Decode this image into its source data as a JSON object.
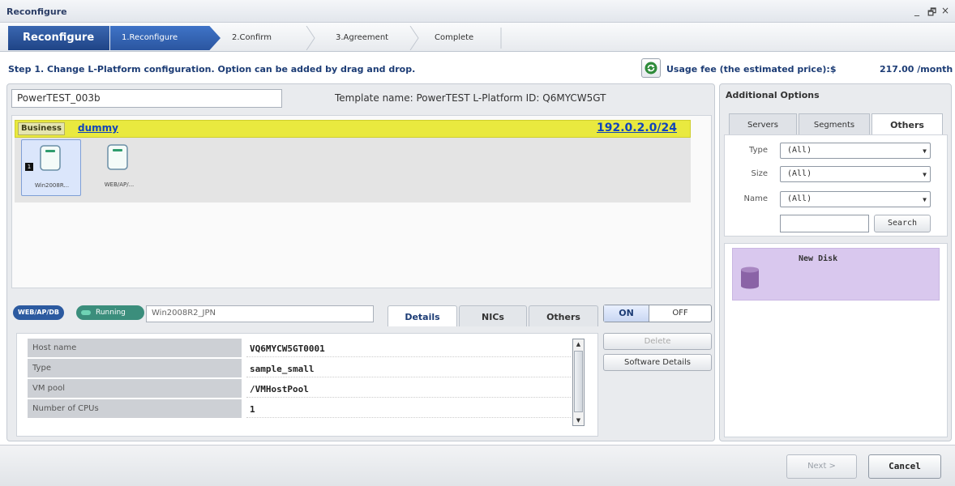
{
  "window": {
    "title": "Reconfigure",
    "controls": {
      "minimize": "_",
      "restore": "🗗",
      "close": "×"
    }
  },
  "wizard": {
    "head": "Reconfigure",
    "steps": [
      {
        "label": "1.Reconfigure"
      },
      {
        "label": "2.Confirm"
      },
      {
        "label": "3.Agreement"
      },
      {
        "label": "Complete"
      }
    ]
  },
  "step_text": "Step 1. Change L-Platform configuration. Option can be added by drag and drop.",
  "usage": {
    "label": "Usage fee (the estimated price):$",
    "value": "217.00 /month"
  },
  "platform": {
    "name": "PowerTEST_003b",
    "template_info": "Template name: PowerTEST  L-Platform ID: Q6MYCW5GT"
  },
  "segment": {
    "badge": "Business",
    "name": "dummy",
    "network": "192.0.2.0/24",
    "servers": [
      {
        "label": "Win2008R...",
        "badge": "1"
      },
      {
        "label": "WEB/AP/..."
      }
    ]
  },
  "server_detail": {
    "type_pill": "WEB/AP/DB",
    "status_pill": "Running",
    "name_field": "Win2008R2_JPN",
    "tabs": [
      "Details",
      "NICs",
      "Others"
    ],
    "toggle": {
      "on": "ON",
      "off": "OFF"
    },
    "delete_label": "Delete",
    "software_label": "Software Details",
    "rows": [
      {
        "key": "Host name",
        "value": "VQ6MYCW5GT0001"
      },
      {
        "key": "Type",
        "value": "sample_small"
      },
      {
        "key": "VM pool",
        "value": "/VMHostPool"
      },
      {
        "key": "Number of CPUs",
        "value": "1"
      }
    ]
  },
  "options": {
    "title": "Additional Options",
    "tabs": [
      "Servers",
      "Segments",
      "Others"
    ],
    "filters": [
      {
        "label": "Type",
        "value": "(All)"
      },
      {
        "label": "Size",
        "value": "(All)"
      },
      {
        "label": "Name",
        "value": "(All)"
      }
    ],
    "search_value": "",
    "search_label": "Search",
    "items": [
      {
        "label": "New Disk",
        "icon": "disk-icon"
      }
    ]
  },
  "footer": {
    "next": "Next >",
    "cancel": "Cancel"
  },
  "colors": {
    "accent": "#2b56a0",
    "segment": "#e9e93f",
    "running": "#3b8e7c",
    "disk": "#d9c8ee"
  }
}
